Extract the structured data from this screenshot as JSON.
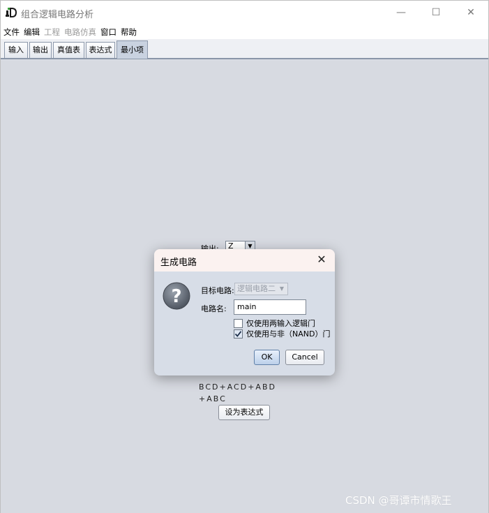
{
  "window": {
    "title": "组合逻辑电路分析",
    "controls": {
      "minimize": "—",
      "maximize": "☐",
      "close": "✕"
    }
  },
  "menu": [
    {
      "label": "文件",
      "enabled": true
    },
    {
      "label": "编辑",
      "enabled": true
    },
    {
      "label": "工程",
      "enabled": false
    },
    {
      "label": "电路仿真",
      "enabled": false
    },
    {
      "label": "窗口",
      "enabled": true
    },
    {
      "label": "帮助",
      "enabled": true
    }
  ],
  "tabs": [
    {
      "label": "输入",
      "active": false
    },
    {
      "label": "输出",
      "active": false
    },
    {
      "label": "真值表",
      "active": false
    },
    {
      "label": "表达式",
      "active": false
    },
    {
      "label": "最小项",
      "active": true
    }
  ],
  "main": {
    "output_label": "输出:",
    "output_value": "Z",
    "expression_lines": [
      "BCD+ACD+ABD",
      "+ABC"
    ],
    "set_expression_button": "设为表达式"
  },
  "dialog": {
    "title": "生成电路",
    "close": "✕",
    "target_label": "目标电路:",
    "target_value": "逻辑电路二",
    "name_label": "电路名:",
    "name_value": "main",
    "options": [
      {
        "label": "仅使用两输入逻辑门",
        "checked": false
      },
      {
        "label": "仅使用与非（NAND）门",
        "checked": true
      }
    ],
    "ok": "OK",
    "cancel": "Cancel"
  },
  "watermark": "CSDN @哥谭市情歌王"
}
